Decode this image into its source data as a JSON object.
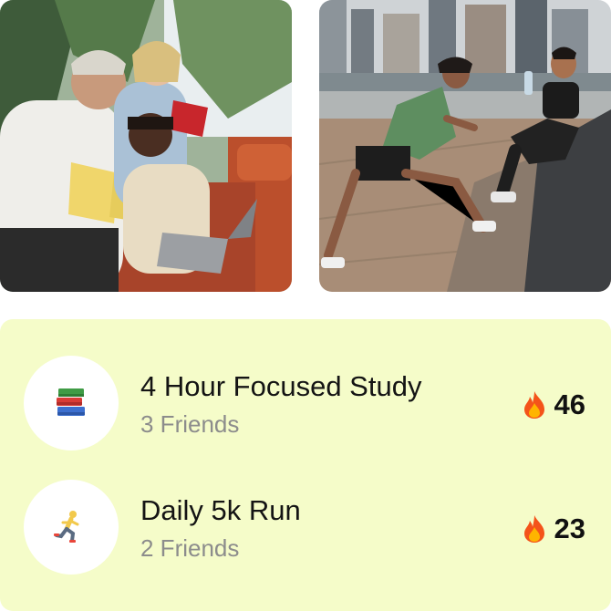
{
  "photos": [
    {
      "subject": "friends-studying"
    },
    {
      "subject": "couple-stretching-waterfront"
    }
  ],
  "challenges": [
    {
      "icon": "books-icon",
      "title": "4 Hour Focused Study",
      "friends": "3 Friends",
      "streak_icon": "fire-icon",
      "streak": "46"
    },
    {
      "icon": "runner-icon",
      "title": "Daily 5k Run",
      "friends": "2 Friends",
      "streak_icon": "fire-icon",
      "streak": "23"
    }
  ],
  "colors": {
    "card_bg": "#f5fcc9",
    "title": "#141414",
    "subtitle": "#8c8c8c"
  }
}
